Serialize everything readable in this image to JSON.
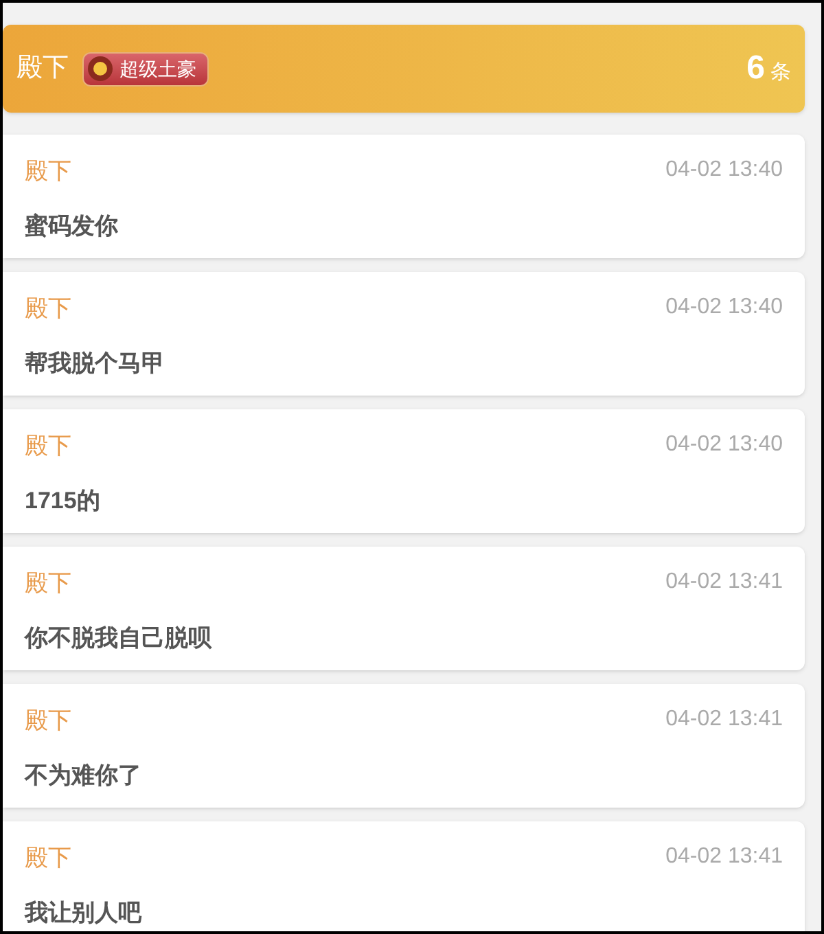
{
  "header": {
    "name": "殿下",
    "badge": "超级土豪",
    "count": "6",
    "count_unit": "条"
  },
  "messages": [
    {
      "sender": "殿下",
      "time": "04-02 13:40",
      "text": "蜜码发你"
    },
    {
      "sender": "殿下",
      "time": "04-02 13:40",
      "text": "帮我脱个马甲"
    },
    {
      "sender": "殿下",
      "time": "04-02 13:40",
      "text": "1715的"
    },
    {
      "sender": "殿下",
      "time": "04-02 13:41",
      "text": "你不脱我自己脱呗"
    },
    {
      "sender": "殿下",
      "time": "04-02 13:41",
      "text": "不为难你了"
    },
    {
      "sender": "殿下",
      "time": "04-02 13:41",
      "text": "我让别人吧"
    }
  ]
}
